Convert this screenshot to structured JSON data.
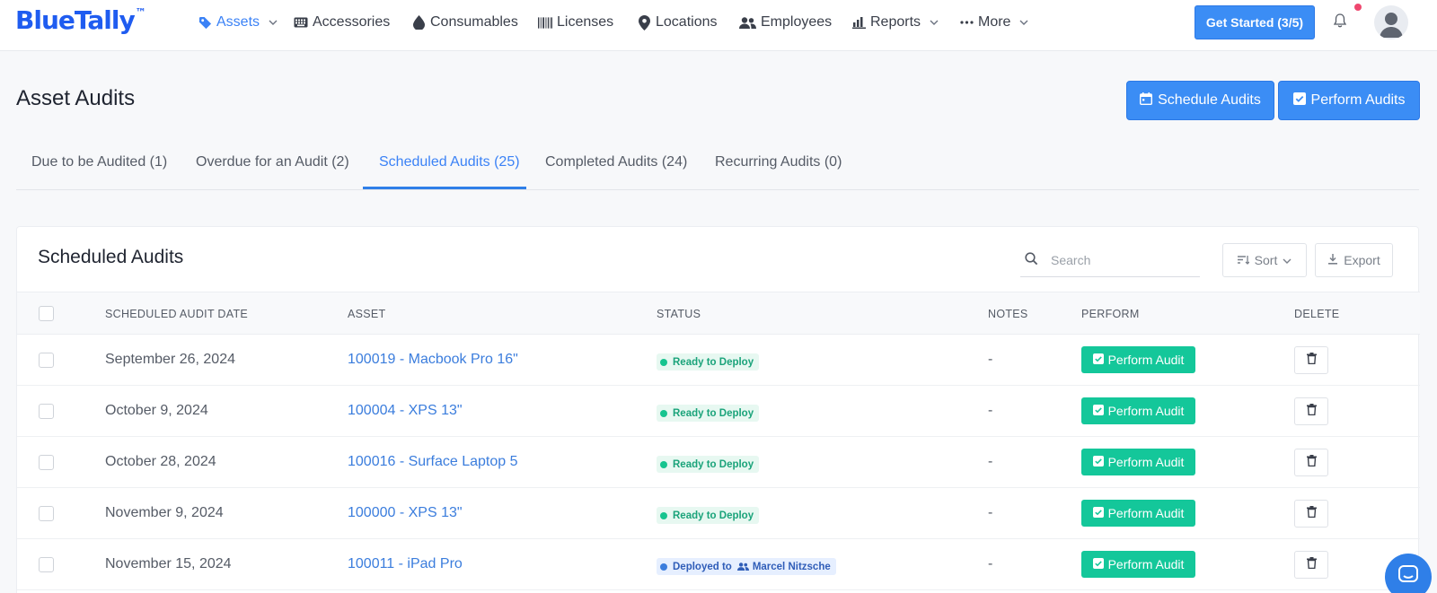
{
  "brand": {
    "logo": "BlueTally",
    "trademark": "™"
  },
  "nav": {
    "items": [
      {
        "label": "Assets",
        "icon": "tag-icon",
        "active": true,
        "dropdown": true
      },
      {
        "label": "Accessories",
        "icon": "keyboard-icon"
      },
      {
        "label": "Consumables",
        "icon": "drop-icon"
      },
      {
        "label": "Licenses",
        "icon": "barcode-icon"
      },
      {
        "label": "Locations",
        "icon": "map-pin-icon"
      },
      {
        "label": "Employees",
        "icon": "users-icon"
      },
      {
        "label": "Reports",
        "icon": "bar-chart-icon",
        "dropdown": true
      },
      {
        "label": "More",
        "icon": "ellipsis-icon",
        "dropdown": true
      }
    ],
    "get_started": "Get Started (3/5)"
  },
  "page": {
    "title": "Asset Audits",
    "schedule_button": "Schedule Audits",
    "perform_button": "Perform Audits"
  },
  "tabs": [
    {
      "label": "Due to be Audited (1)"
    },
    {
      "label": "Overdue for an Audit (2)"
    },
    {
      "label": "Scheduled Audits (25)",
      "active": true
    },
    {
      "label": "Completed Audits (24)"
    },
    {
      "label": "Recurring Audits (0)"
    }
  ],
  "card": {
    "title": "Scheduled Audits",
    "search_placeholder": "Search",
    "sort_label": "Sort",
    "export_label": "Export"
  },
  "table": {
    "headers": {
      "date": "SCHEDULED AUDIT DATE",
      "asset": "ASSET",
      "status": "STATUS",
      "notes": "NOTES",
      "perform": "PERFORM",
      "delete": "DELETE"
    },
    "perform_label": "Perform Audit",
    "rows": [
      {
        "date": "September 26, 2024",
        "asset": "100019 - Macbook Pro 16\"",
        "status": "Ready to Deploy",
        "status_color": "#16c48f",
        "notes": "-"
      },
      {
        "date": "October 9, 2024",
        "asset": "100004 - XPS 13\"",
        "status": "Ready to Deploy",
        "status_color": "#16c48f",
        "notes": "-"
      },
      {
        "date": "October 28, 2024",
        "asset": "100016 - Surface Laptop 5",
        "status": "Ready to Deploy",
        "status_color": "#16c48f",
        "notes": "-"
      },
      {
        "date": "November 9, 2024",
        "asset": "100000 - XPS 13\"",
        "status": "Ready to Deploy",
        "status_color": "#16c48f",
        "notes": "-"
      },
      {
        "date": "November 15, 2024",
        "asset": "100011 - iPad Pro",
        "status": "Deployed to",
        "status_user": "Marcel Nitzsche",
        "status_color": "#3b7ddd",
        "notes": "-"
      }
    ]
  },
  "colors": {
    "primary": "#3b8df5",
    "success": "#14c79a",
    "link": "#3b7ddd"
  }
}
